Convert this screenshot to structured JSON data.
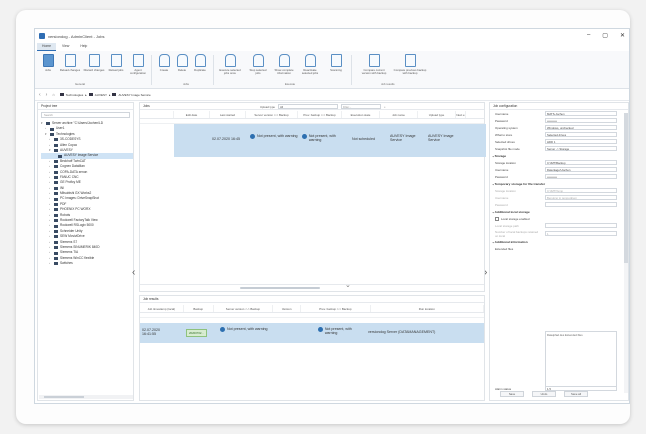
{
  "window": {
    "title": "versiondog - AdminClient - Jobs",
    "controls": [
      "–",
      "▢",
      "✕"
    ]
  },
  "menu_tabs": [
    "Home",
    "View",
    "Help"
  ],
  "ribbon": {
    "groups": {
      "general": "General",
      "jobs": "Jobs",
      "execute": "Execute",
      "job_results": "Job results"
    },
    "buttons": [
      {
        "label": "Jobs",
        "icon": "jobs-icon"
      },
      {
        "label": "Reload changes",
        "icon": "reload-icon"
      },
      {
        "label": "Discard changes",
        "icon": "discard-icon"
      },
      {
        "label": "Reload jobs",
        "icon": "reload-jobs-icon"
      },
      {
        "label": "Agent configuration",
        "icon": "agent-icon"
      },
      {
        "label": "Create",
        "icon": "create-icon"
      },
      {
        "label": "Delete",
        "icon": "delete-icon"
      },
      {
        "label": "Duplicate",
        "icon": "duplicate-icon"
      },
      {
        "label": "Execute selected jobs once",
        "icon": "execute-icon"
      },
      {
        "label": "Stop selected jobs",
        "icon": "stop-icon"
      },
      {
        "label": "Show complete information",
        "icon": "info-icon"
      },
      {
        "label": "Reactivate selected jobs",
        "icon": "reactivate-icon"
      },
      {
        "label": "Scanning",
        "icon": "scan-icon"
      },
      {
        "label": "Compare current version with backup",
        "icon": "compare-icon"
      },
      {
        "label": "Compare previous backup with backup",
        "icon": "compare-prev-icon"
      }
    ]
  },
  "navbar": {
    "crumbs": [
      "Technologies",
      "AUVESY",
      "AUVESY Image Service"
    ]
  },
  "project_tree": {
    "title": "Project tree",
    "search_placeholder": "Search",
    "items": [
      {
        "label": "Server archive \"C:\\Users\\Jochen\\LD",
        "level": 0,
        "expanded": true
      },
      {
        "label": "User1",
        "level": 1,
        "expanded": false
      },
      {
        "label": "Technologies",
        "level": 1,
        "expanded": true
      },
      {
        "label": "3S-CODESYS",
        "level": 2,
        "expanded": false
      },
      {
        "label": "Allen Copco",
        "level": 2,
        "expanded": false
      },
      {
        "label": "AUVESY",
        "level": 2,
        "expanded": true
      },
      {
        "label": "AUVESY Image Service",
        "level": 3,
        "selected": true
      },
      {
        "label": "Beckhoff TwinCAT",
        "level": 2,
        "expanded": false
      },
      {
        "label": "Cognex DataMan",
        "level": 2,
        "expanded": false
      },
      {
        "label": "COPA-DATA zenon",
        "level": 2,
        "expanded": false
      },
      {
        "label": "FANUC CNC",
        "level": 2,
        "expanded": false
      },
      {
        "label": "GE Proficy ME",
        "level": 2,
        "expanded": false
      },
      {
        "label": "INI",
        "level": 2,
        "expanded": false
      },
      {
        "label": "Mitsubishi GX Works2",
        "level": 2,
        "expanded": false
      },
      {
        "label": "PC Images: DriveSnapShot",
        "level": 2,
        "expanded": false
      },
      {
        "label": "PDF",
        "level": 2,
        "expanded": false
      },
      {
        "label": "PHOENIX PC WORX",
        "level": 2,
        "expanded": false
      },
      {
        "label": "Robots",
        "level": 2,
        "expanded": false
      },
      {
        "label": "Rockwell FactoryTalk View",
        "level": 2,
        "expanded": false
      },
      {
        "label": "Rockwell RSLogix 5000",
        "level": 2,
        "expanded": false
      },
      {
        "label": "Schneider Unity",
        "level": 2,
        "expanded": false
      },
      {
        "label": "SEW MoviviDrive",
        "level": 2,
        "expanded": false
      },
      {
        "label": "Siemens S7",
        "level": 2,
        "expanded": false
      },
      {
        "label": "Siemens SINUMERIK 840D",
        "level": 2,
        "expanded": false
      },
      {
        "label": "Siemens TIA",
        "level": 2,
        "expanded": false
      },
      {
        "label": "Siemens WinCC flexible",
        "level": 2,
        "expanded": false
      },
      {
        "label": "Switches",
        "level": 2,
        "expanded": false
      }
    ]
  },
  "jobs_panel": {
    "title": "Jobs",
    "filter_label": "Upload type",
    "filter_value": "All",
    "search_placeholder": "Filter...",
    "columns": [
      "Edit date",
      "Last started",
      "Server version <-> Backup",
      "Prev. backup <-> Backup",
      "Execution state",
      "Job name",
      "Upload type",
      "Next e"
    ],
    "rows": [
      {
        "edit_date": "",
        "last_started": "02.07.2020 16:45",
        "server_vs_backup": "Not present, with warning",
        "prev_vs_backup": "Not present, with warning",
        "execution_state": "Not scheduled",
        "job_name": "AUVESY Image Service",
        "upload_type": "AUVESY Image Service"
      }
    ]
  },
  "results_panel": {
    "title": "Job results",
    "columns": [
      "Job timestamp (local)",
      "Backup",
      "Server version <-> Backup",
      "Version",
      "Prev. backup <-> Backup",
      "Run location"
    ],
    "rows": [
      {
        "timestamp": "02.07.2020 16:41:55",
        "backup": "20200702...",
        "server_vs_backup": "Not present, with warning",
        "prev_vs_backup": "Not present, with warning",
        "run_location": "versiondog Server (DATAMANAGEMENT)"
      }
    ]
  },
  "job_config": {
    "title": "Job configuration",
    "fields": [
      {
        "label": "Username",
        "value": "MATS-Jochen"
      },
      {
        "label": "Password",
        "value": "••••••••••"
      },
      {
        "label": "Operating system",
        "value": "Windows, unchecked"
      },
      {
        "label": "What to store",
        "value": "Selected drives"
      },
      {
        "label": "Selected drives",
        "value": "HDD 1"
      },
      {
        "label": "Snapshot file mode",
        "value": "Server -> Storage"
      }
    ],
    "storage": {
      "heading": "Storage",
      "fields": [
        {
          "label": "Storage location",
          "value": "C:\\IMT\\Backup"
        },
        {
          "label": "Username",
          "value": "Datenlager\\Jochen"
        },
        {
          "label": "Password",
          "value": "••••••••••"
        }
      ]
    },
    "temp_storage": {
      "heading": "Temporary storage for file transfer",
      "fields": [
        {
          "label": "Storage location",
          "value": "C:\\IMT\\Temp"
        },
        {
          "label": "Username",
          "value": "Benutzer in temporärem"
        },
        {
          "label": "Password",
          "value": ""
        }
      ]
    },
    "local_storage": {
      "heading": "Additional local storage",
      "checkbox": "Local storage enabled",
      "fields": [
        {
          "label": "Local storage path",
          "value": ""
        },
        {
          "label": "Number of local backups retained on local",
          "value": "1"
        }
      ]
    },
    "additional": {
      "heading": "Additional information",
      "desc_label": "Extended files",
      "desc_value": "Dateipfad des Extended files",
      "alarm_label": "Alarm status",
      "alarm_value": "1.5"
    },
    "buttons": [
      "Save",
      "Undo",
      "Save all"
    ]
  }
}
